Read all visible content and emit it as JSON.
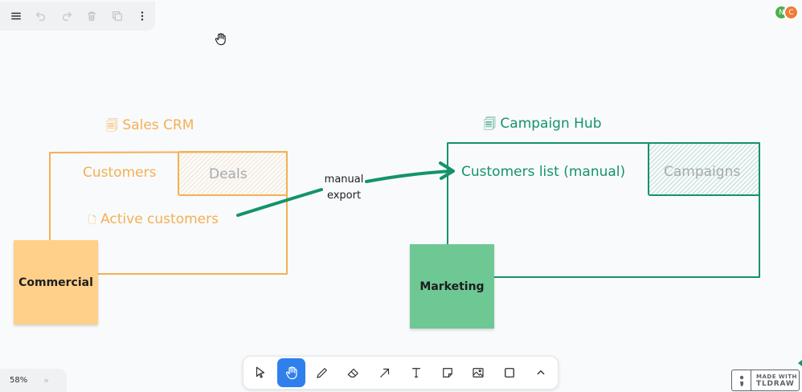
{
  "colors": {
    "orange": "#f2b154",
    "green": "#14936a",
    "sticky_orange": "#ffd08a",
    "sticky_green": "#6ec894",
    "tool_active": "#2f80ed"
  },
  "menu": {
    "items": [
      {
        "icon": "hamburger-menu-icon",
        "enabled": true
      },
      {
        "icon": "undo-icon",
        "enabled": false
      },
      {
        "icon": "redo-icon",
        "enabled": false
      },
      {
        "icon": "trash-icon",
        "enabled": false
      },
      {
        "icon": "duplicate-icon",
        "enabled": false
      },
      {
        "icon": "more-vertical-icon",
        "enabled": true
      }
    ]
  },
  "avatars": [
    {
      "initial": "N",
      "color": "#4caf50"
    },
    {
      "initial": "C",
      "color": "#f07b38"
    }
  ],
  "diagram": {
    "left_frame": {
      "title": "Sales CRM",
      "title_icon": "document-stack-icon",
      "section_customers": "Customers",
      "section_deals": "Deals",
      "item": "Active customers",
      "item_icon": "document-icon"
    },
    "right_frame": {
      "title": "Campaign Hub",
      "title_icon": "document-stack-icon",
      "item": "Customers list (manual)",
      "section_campaigns": "Campaigns"
    },
    "arrow_label_line1": "manual",
    "arrow_label_line2": "export",
    "sticky_left": "Commercial",
    "sticky_right": "Marketing"
  },
  "toolbar": {
    "tools": [
      {
        "name": "select",
        "icon": "cursor-icon",
        "active": false
      },
      {
        "name": "hand",
        "icon": "hand-icon",
        "active": true
      },
      {
        "name": "draw",
        "icon": "pencil-icon",
        "active": false
      },
      {
        "name": "eraser",
        "icon": "eraser-icon",
        "active": false
      },
      {
        "name": "arrow",
        "icon": "arrow-icon",
        "active": false
      },
      {
        "name": "text",
        "icon": "text-icon",
        "active": false
      },
      {
        "name": "note",
        "icon": "sticky-note-icon",
        "active": false
      },
      {
        "name": "media",
        "icon": "image-icon",
        "active": false
      },
      {
        "name": "rectangle",
        "icon": "rectangle-icon",
        "active": false
      },
      {
        "name": "more",
        "icon": "chevron-up-icon",
        "active": false
      }
    ]
  },
  "zoom": {
    "level": "58%",
    "expand_glyph": "»"
  },
  "badge": {
    "line1": "MADE WITH",
    "line2": "TLDRAW"
  }
}
